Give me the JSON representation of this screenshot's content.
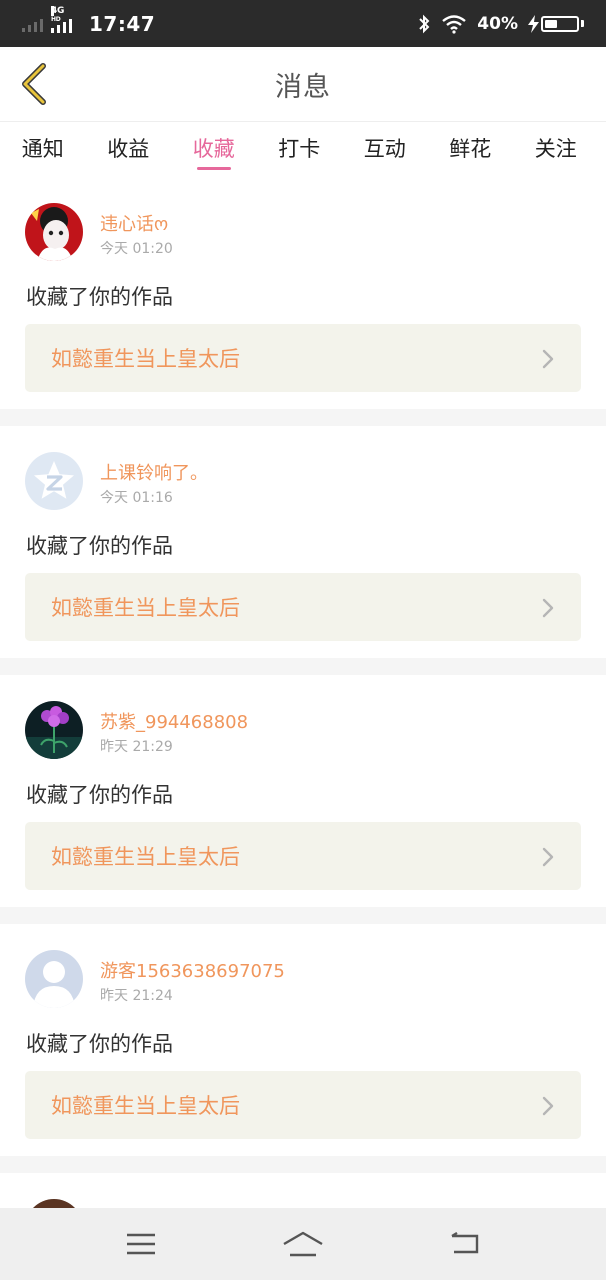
{
  "status_bar": {
    "time": "17:47",
    "network": "4G",
    "network_hd": "HD",
    "battery": "40%",
    "battery_level": 0.4,
    "icons": [
      "signal-icon",
      "bluetooth-icon",
      "wifi-icon",
      "charging-icon",
      "battery-icon"
    ]
  },
  "header": {
    "title": "消息",
    "back_icon": "chevron-left-icon",
    "accent": "#e6689b"
  },
  "tabs": [
    {
      "label": "通知",
      "active": false
    },
    {
      "label": "收益",
      "active": false
    },
    {
      "label": "收藏",
      "active": true
    },
    {
      "label": "打卡",
      "active": false
    },
    {
      "label": "互动",
      "active": false
    },
    {
      "label": "鲜花",
      "active": false
    },
    {
      "label": "关注",
      "active": false
    }
  ],
  "messages": [
    {
      "user": "违心话ო",
      "time": "今天 01:20",
      "action": "收藏了你的作品",
      "work": "如懿重生当上皇太后"
    },
    {
      "user": "上课铃响了。",
      "time": "今天 01:16",
      "action": "收藏了你的作品",
      "work": "如懿重生当上皇太后"
    },
    {
      "user": "苏紫_994468808",
      "time": "昨天 21:29",
      "action": "收藏了你的作品",
      "work": "如懿重生当上皇太后"
    },
    {
      "user": "游客1563638697075",
      "time": "昨天 21:24",
      "action": "收藏了你的作品",
      "work": "如懿重生当上皇太后"
    }
  ],
  "nav_bar": {
    "icons": [
      "menu-icon",
      "home-icon",
      "back-icon"
    ]
  },
  "colors": {
    "name_orange": "#f0965c",
    "card_bg": "#f3f3eb",
    "status_bar_bg": "#2b2b2b"
  }
}
